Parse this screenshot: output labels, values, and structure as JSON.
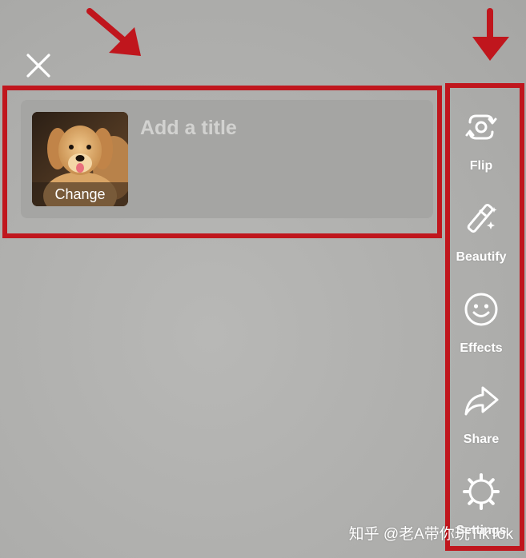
{
  "close": {
    "icon": "close-icon"
  },
  "title_card": {
    "cover_change_label": "Change",
    "title_placeholder": "Add a title"
  },
  "side_tools": [
    {
      "label": "Flip",
      "icon": "flip-camera-icon"
    },
    {
      "label": "Beautify",
      "icon": "magic-wand-icon"
    },
    {
      "label": "Effects",
      "icon": "smiley-face-icon"
    },
    {
      "label": "Share",
      "icon": "share-arrow-icon"
    },
    {
      "label": "Settings",
      "icon": "gear-icon"
    }
  ],
  "annotation": {
    "highlight_color": "#c0161d"
  },
  "watermark": "知乎 @老A带你玩TikTok"
}
